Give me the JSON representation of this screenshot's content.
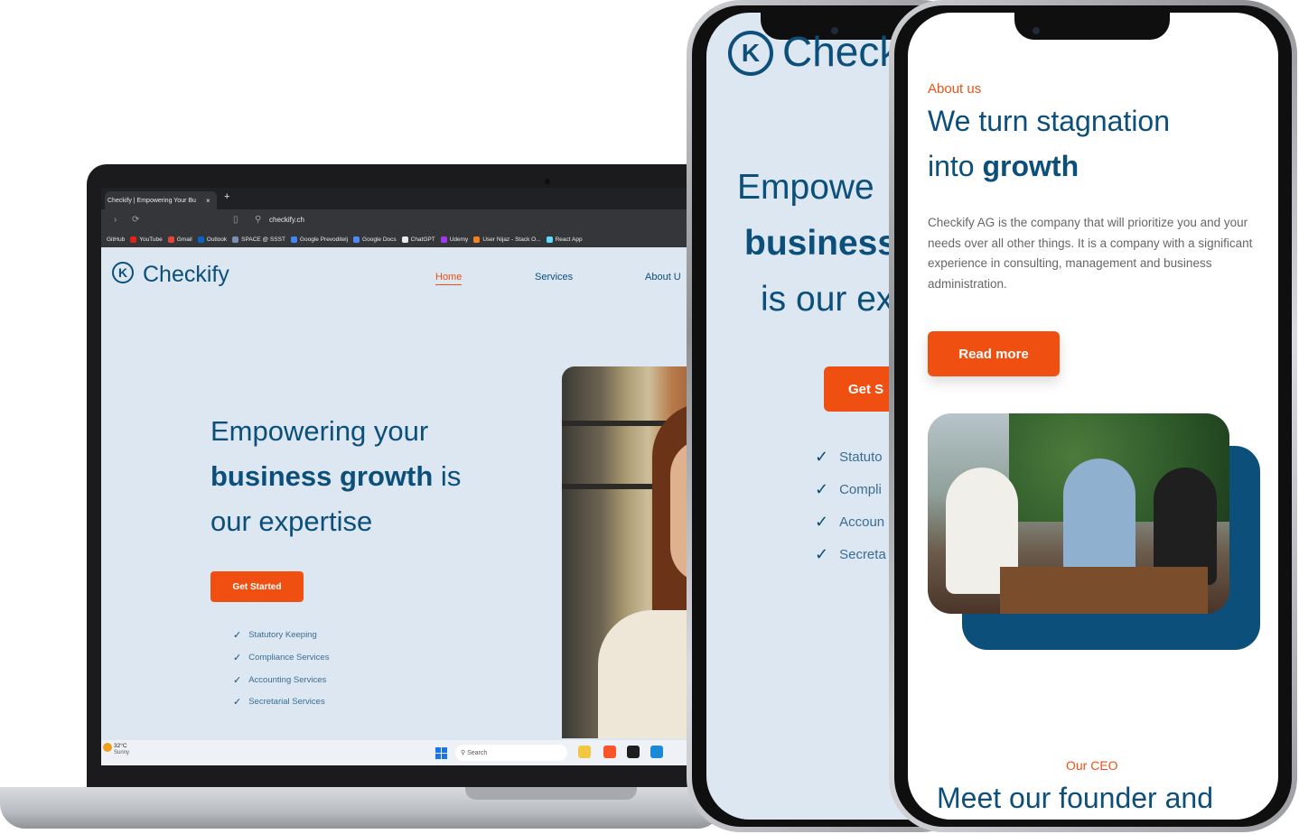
{
  "browser": {
    "tab_title": "Checkify | Empowering Your Bu",
    "tab_close": "×",
    "new_tab": "+",
    "url": "checkify.ch",
    "bookmarks": [
      "GitHub",
      "YouTube",
      "Gmail",
      "Outlook",
      "SPACE @ SSST",
      "Google Prevoditelj",
      "Google Docs",
      "ChatGPT",
      "Udemy",
      "User Nijaz - Stack O...",
      "React App"
    ]
  },
  "site": {
    "logo_mark": "K",
    "logo_text": "Checkify",
    "nav": [
      "Home",
      "Services",
      "About U"
    ],
    "hero_line1": "Empowering your",
    "hero_bold": "business growth",
    "hero_is": " is",
    "hero_line3": "our expertise",
    "cta": "Get Started",
    "services": [
      "Statutory Keeping",
      "Compliance Services",
      "Accounting Services",
      "Secretarial Services"
    ]
  },
  "taskbar": {
    "weather_temp": "32°C",
    "weather_text": "Sunny",
    "search_placeholder": "Search"
  },
  "phone1": {
    "logo_mark": "K",
    "logo_text": "Check",
    "hero_line1": "Empowe",
    "hero_bold": "business",
    "hero_line3": "is our ex",
    "cta": "Get S",
    "services": [
      "Statuto",
      "Compli",
      "Accoun",
      "Secreta"
    ]
  },
  "phone2": {
    "kicker": "About us",
    "title_line1": "We turn stagnation",
    "title_line2_pre": "into ",
    "title_line2_bold": "growth",
    "paragraph": "Checkify AG is the company that will prioritize you and your needs over all other things. It is a company with a significant experience in consulting, management and business administration.",
    "button": "Read more",
    "ceo_kicker": "Our CEO",
    "ceo_title": "Meet our founder and"
  },
  "colors": {
    "brand_blue": "#0c4f7a",
    "accent_orange": "#f04f12",
    "site_bg": "#dce7f1"
  }
}
